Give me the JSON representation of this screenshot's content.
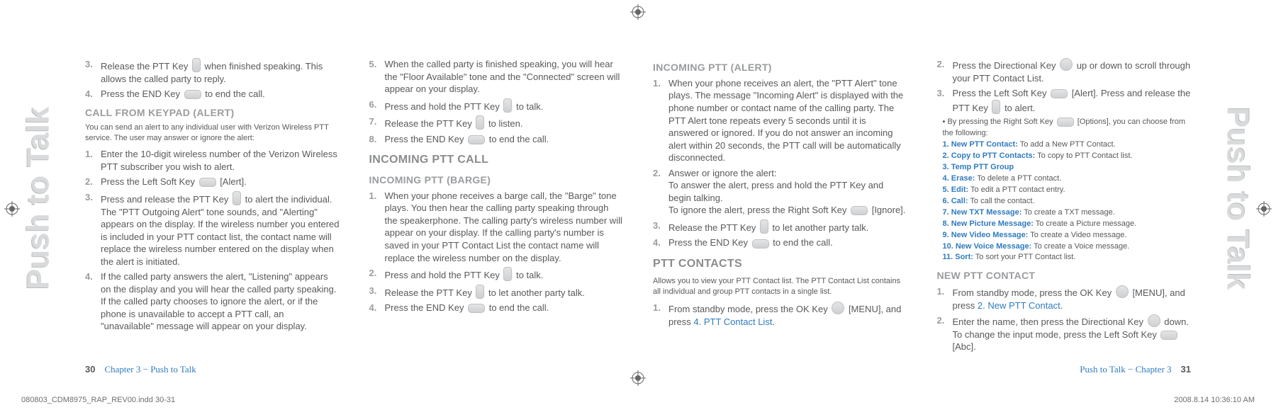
{
  "sidetab": "Push to Talk",
  "col1": {
    "list1": [
      {
        "n": "3.",
        "before": "Release the PTT Key ",
        "after": " when finished speaking. This allows the called party to reply."
      },
      {
        "n": "4.",
        "before": "Press the END Key ",
        "after": " to end the call."
      }
    ],
    "h2a": "CALL FROM KEYPAD (ALERT)",
    "fine": "You can send an alert to any individual user with Verizon Wireless PTT service. The user may answer or ignore the alert:",
    "list2": [
      {
        "n": "1.",
        "text": "Enter the 10-digit wireless number of the Verizon Wireless PTT subscriber you wish to alert."
      },
      {
        "n": "2.",
        "before": "Press the Left Soft Key ",
        "after": " [Alert]."
      },
      {
        "n": "3.",
        "before": "Press and release the PTT Key ",
        "after": " to alert the individual. The \"PTT Outgoing Alert\" tone sounds, and \"Alerting\" appears on the display. If the wireless number you entered is included in your PTT contact list, the contact name will replace the wireless number entered on the display when the alert is initiated."
      },
      {
        "n": "4.",
        "text": "If the called party answers the alert, \"Listening\" appears on the display and you will hear the called party speaking. If the called party chooses to ignore the alert, or if the phone is unavailable to accept a PTT call, an \"unavailable\" message will appear on your display."
      }
    ]
  },
  "col2": {
    "list1": [
      {
        "n": "5.",
        "text": "When the called party is finished speaking, you will hear the \"Floor Available\" tone and the \"Connected\" screen will appear on your display."
      },
      {
        "n": "6.",
        "before": "Press and hold the PTT Key ",
        "after": " to talk."
      },
      {
        "n": "7.",
        "before": "Release the PTT Key ",
        "after": " to listen."
      },
      {
        "n": "8.",
        "before": "Press the END Key ",
        "after": " to end the call."
      }
    ],
    "h1": "INCOMING PTT CALL",
    "h2": "INCOMING PTT (BARGE)",
    "list2": [
      {
        "n": "1.",
        "text": "When your phone receives a barge call, the \"Barge\" tone plays. You then hear the calling party speaking through the speakerphone. The calling party's wireless number will appear on your display. If the calling party's number is saved in your PTT Contact List the contact name will replace the wireless number on the display."
      },
      {
        "n": "2.",
        "before": "Press and hold the PTT Key ",
        "after": " to talk."
      },
      {
        "n": "3.",
        "before": "Release the PTT Key ",
        "after": " to let another party talk."
      },
      {
        "n": "4.",
        "before": "Press the END Key ",
        "after": " to end the call."
      }
    ]
  },
  "col3": {
    "h2a": "INCOMING PTT (ALERT)",
    "list1": [
      {
        "n": "1.",
        "text": "When your phone receives an alert, the \"PTT Alert\" tone plays. The message \"Incoming Alert\" is displayed with the phone number or contact name of the calling party. The PTT Alert tone repeats every 5 seconds until it is answered or ignored. If you do not answer an incoming alert within 20 seconds, the PTT call will be automatically disconnected."
      },
      {
        "n": "2.",
        "a": "Answer or ignore the alert:",
        "b": "To answer the alert, press and hold the PTT Key and begin talking.",
        "c_before": "To ignore the alert, press the Right Soft Key ",
        "c_after": " [Ignore]."
      },
      {
        "n": "3.",
        "before": "Release the PTT Key ",
        "after": " to let another party talk."
      },
      {
        "n": "4.",
        "before": "Press the END Key ",
        "after": " to end the call."
      }
    ],
    "h1": "PTT CONTACTS",
    "fine": "Allows you to view your PTT Contact list. The PTT Contact List contains all individual and group PTT contacts in a single list.",
    "list2_pre": "From standby mode, press the OK Key ",
    "list2_mid": " [MENU], and press ",
    "list2_link": "4. PTT Contact List",
    "list2_end": "."
  },
  "col4": {
    "list1": [
      {
        "n": "2.",
        "before": "Press the Directional Key ",
        "after": " up or down to scroll through your PTT Contact List."
      },
      {
        "n": "3.",
        "before": "Press the Left Soft Key ",
        "mid": " [Alert]. Press and release the PTT Key ",
        "after": " to alert."
      }
    ],
    "tip_lead": "By pressing the Right Soft Key ",
    "tip_lead2": " [Options], you can choose from the following:",
    "tips": [
      {
        "h": "1. New PTT Contact:",
        "t": " To add a New PTT Contact."
      },
      {
        "h": "2. Copy to PTT Contacts:",
        "t": " To copy to PTT Contact list."
      },
      {
        "h": "3. Temp PTT Group",
        "t": ""
      },
      {
        "h": "4. Erase:",
        "t": " To delete a PTT contact."
      },
      {
        "h": "5. Edit:",
        "t": " To edit a PTT contact entry."
      },
      {
        "h": "6. Call:",
        "t": " To call the contact."
      },
      {
        "h": "7. New TXT Message:",
        "t": " To create a TXT message."
      },
      {
        "h": "8. New Picture Message:",
        "t": " To create a Picture message."
      },
      {
        "h": "9. New Video Message:",
        "t": " To create a Video message."
      },
      {
        "h": "10. New Voice Message:",
        "t": " To create a Voice message."
      },
      {
        "h": "11. Sort:",
        "t": " To sort your PTT Contact list."
      }
    ],
    "h2": "NEW PTT CONTACT",
    "s1_pre": "From standby mode, press the OK Key ",
    "s1_mid": " [MENU], and press ",
    "s1_link": "2. New PTT Contact",
    "s1_end": ".",
    "s2_pre": "Enter the name, then press the Directional Key ",
    "s2_mid": " down. To change the input mode, press the Left Soft Key ",
    "s2_end": " [Abc]."
  },
  "footer": {
    "leftPage": "30",
    "leftChap": "Chapter 3 − Push to Talk",
    "rightChap": "Push to Talk − Chapter 3",
    "rightPage": "31",
    "file": "080803_CDM8975_RAP_REV00.indd   30-31",
    "stamp": "2008.8.14   10:36:10 AM"
  }
}
